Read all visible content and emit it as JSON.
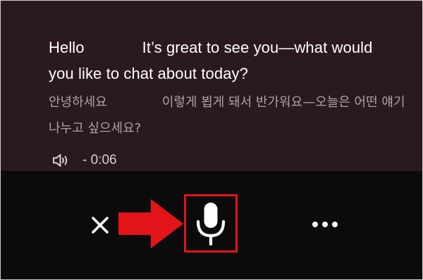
{
  "message": {
    "english_greeting": "Hello",
    "english_rest": "It’s great to see you—what would you like to chat about today?",
    "korean_greeting": "안녕하세요",
    "korean_rest": "이렇게 뵙게 돼서 반가워요—오늘은 어떤 얘기 나누고 싶으세요?",
    "audio_duration": "- 0:06",
    "audio_icon": "speaker-icon"
  },
  "controls": {
    "close_icon": "close-icon",
    "mic_icon": "microphone-icon",
    "more_icon": "more-options-icon",
    "annotation_icon": "arrow-right-icon"
  },
  "colors": {
    "message_background": "#2a1a1e",
    "controls_background": "#0b0b0c",
    "primary_text": "#ffffff",
    "translation_text": "#a9a3a4",
    "highlight_red": "#e3141a"
  }
}
